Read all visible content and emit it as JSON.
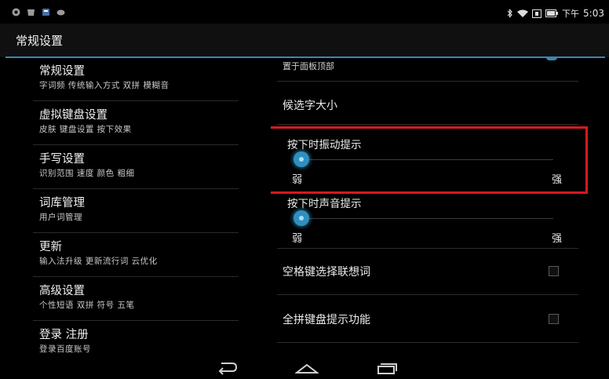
{
  "status_bar": {
    "time": "5:03",
    "ampm": "下午",
    "left_icons": [
      "app-icon-1",
      "app-icon-2",
      "app-icon-3",
      "app-icon-4"
    ],
    "right_icons": [
      "bluetooth-icon",
      "wifi-icon",
      "battery-icon"
    ]
  },
  "header": {
    "title": "常规设置",
    "accent_color": "#3a87b3"
  },
  "categories": [
    {
      "title": "常规设置",
      "subtitle": "字词频 传统输入方式 双拼 模糊音"
    },
    {
      "title": "虚拟键盘设置",
      "subtitle": "皮肤 键盘设置 按下效果"
    },
    {
      "title": "手写设置",
      "subtitle": "识别范围 速度 颜色 粗细"
    },
    {
      "title": "词库管理",
      "subtitle": "用户词管理"
    },
    {
      "title": "更新",
      "subtitle": "输入法升级 更新流行词 云优化"
    },
    {
      "title": "高级设置",
      "subtitle": "个性短语 双拼 符号 五笔"
    },
    {
      "title": "登录 注册",
      "subtitle": "登录百度账号"
    }
  ],
  "settings": {
    "partial_item": "置于面板顶部",
    "candidate_size": "候选字大小",
    "vibration": {
      "label": "按下时振动提示",
      "min_label": "弱",
      "max_label": "强",
      "level": 0.0
    },
    "sound": {
      "label": "按下时声音提示",
      "min_label": "弱",
      "max_label": "强",
      "level": 0.0
    },
    "space_select": {
      "label": "空格键选择联想词",
      "checked": false
    },
    "pinyin_hint": {
      "label": "全拼键盘提示功能",
      "checked": false
    }
  },
  "colors": {
    "highlight": "#d71920",
    "slider": "#2f8fbf"
  },
  "nav": [
    "back-icon",
    "home-icon",
    "recent-apps-icon"
  ]
}
